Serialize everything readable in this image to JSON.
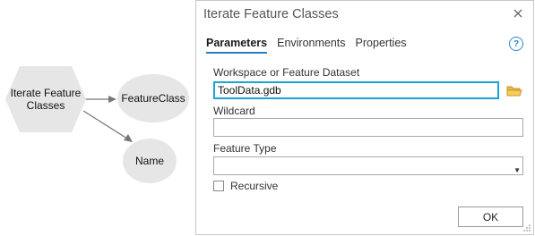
{
  "diagram": {
    "iterator_label": "Iterate Feature\nClasses",
    "output1_label": "FeatureClass",
    "output2_label": "Name",
    "shape_fill": "#e6e6e6",
    "connector_color": "#777777"
  },
  "dialog": {
    "title": "Iterate Feature Classes",
    "close_icon": "close-icon",
    "help_icon": "?",
    "tabs": [
      {
        "label": "Parameters",
        "active": true
      },
      {
        "label": "Environments",
        "active": false
      },
      {
        "label": "Properties",
        "active": false
      }
    ],
    "workspace": {
      "label": "Workspace or Feature Dataset",
      "value": "ToolData.gdb",
      "browse_icon": "folder-icon"
    },
    "wildcard": {
      "label": "Wildcard",
      "value": ""
    },
    "feature_type": {
      "label": "Feature Type",
      "value": ""
    },
    "recursive": {
      "label": "Recursive",
      "checked": false
    },
    "ok_label": "OK",
    "accent_color": "#1aa3d8"
  }
}
